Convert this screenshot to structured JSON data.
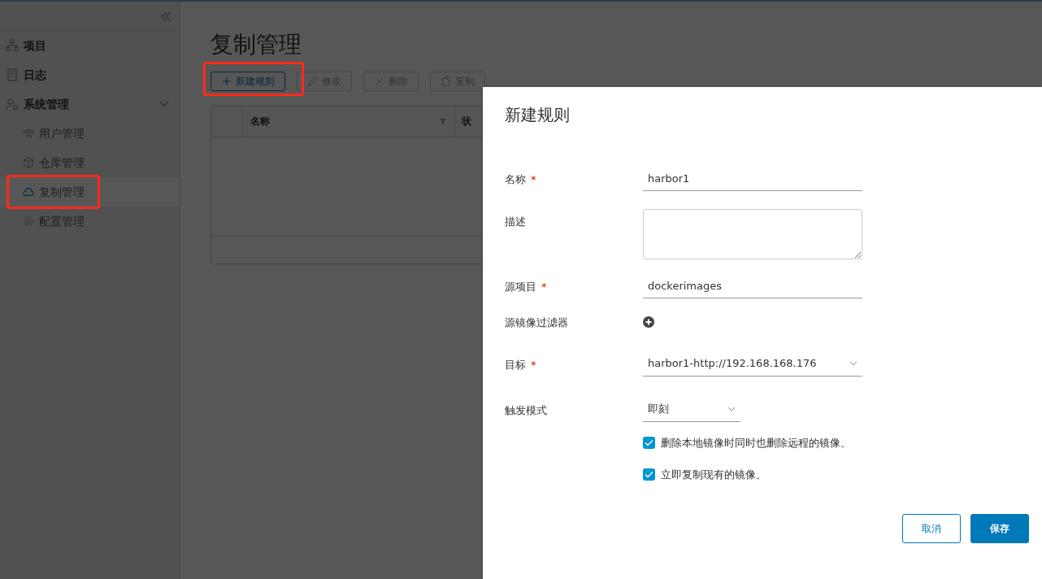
{
  "sidebar": {
    "items": [
      {
        "label": "项目",
        "kind": "top"
      },
      {
        "label": "日志",
        "kind": "top"
      },
      {
        "label": "系统管理",
        "kind": "group",
        "expanded": true,
        "children": [
          {
            "label": "用户管理",
            "selected": false,
            "highlighted": false
          },
          {
            "label": "仓库管理",
            "selected": false,
            "highlighted": false
          },
          {
            "label": "复制管理",
            "selected": true,
            "highlighted": true
          },
          {
            "label": "配置管理",
            "selected": false,
            "highlighted": false
          }
        ]
      }
    ]
  },
  "page": {
    "title": "复制管理",
    "toolbar": [
      {
        "label": "新建规则",
        "disabled": false,
        "highlighted": true
      },
      {
        "label": "修改",
        "disabled": true,
        "highlighted": false
      },
      {
        "label": "删除",
        "disabled": true,
        "highlighted": false
      },
      {
        "label": "复制",
        "disabled": true,
        "highlighted": false
      }
    ],
    "table": {
      "columns": [
        "名称",
        "状"
      ]
    }
  },
  "dialog": {
    "title": "新建规则",
    "fields": [
      {
        "label": "名称",
        "required_mark": "*",
        "kind": "input",
        "value": "harbor1"
      },
      {
        "label": "描述",
        "kind": "textarea"
      },
      {
        "label": "源项目",
        "required_mark": "*",
        "kind": "input",
        "value": "dockerimages"
      },
      {
        "label": "源镜像过滤器",
        "kind": "add"
      },
      {
        "label": "目标",
        "required_mark": "*",
        "kind": "select",
        "value": "harbor1-http://192.168.168.176"
      },
      {
        "label": "触发模式",
        "kind": "select-small",
        "value": "即刻"
      }
    ],
    "checkboxes": [
      {
        "label": "删除本地镜像时同时也删除远程的镜像。",
        "checked": true
      },
      {
        "label": "立即复制现有的镜像。",
        "checked": true
      }
    ],
    "buttons": [
      {
        "label": "取消",
        "kind": "secondary"
      },
      {
        "label": "保存",
        "kind": "primary"
      }
    ]
  }
}
